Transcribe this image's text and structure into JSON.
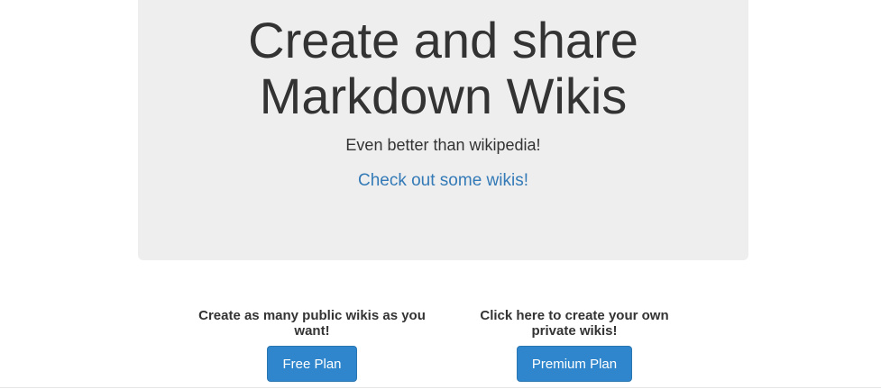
{
  "hero": {
    "title_line1": "Create and share",
    "title_line2": "Markdown Wikis",
    "subtitle": "Even better than wikipedia!",
    "link_label": "Check out some wikis!"
  },
  "plans": {
    "free": {
      "description": "Create as many public wikis as you want!",
      "button_label": "Free Plan"
    },
    "premium": {
      "description": "Click here to create your own private wikis!",
      "button_label": "Premium Plan"
    }
  },
  "colors": {
    "jumbotron_bg": "#eeeeee",
    "link": "#337ab7",
    "button": "#2f86cc",
    "text": "#333333"
  }
}
